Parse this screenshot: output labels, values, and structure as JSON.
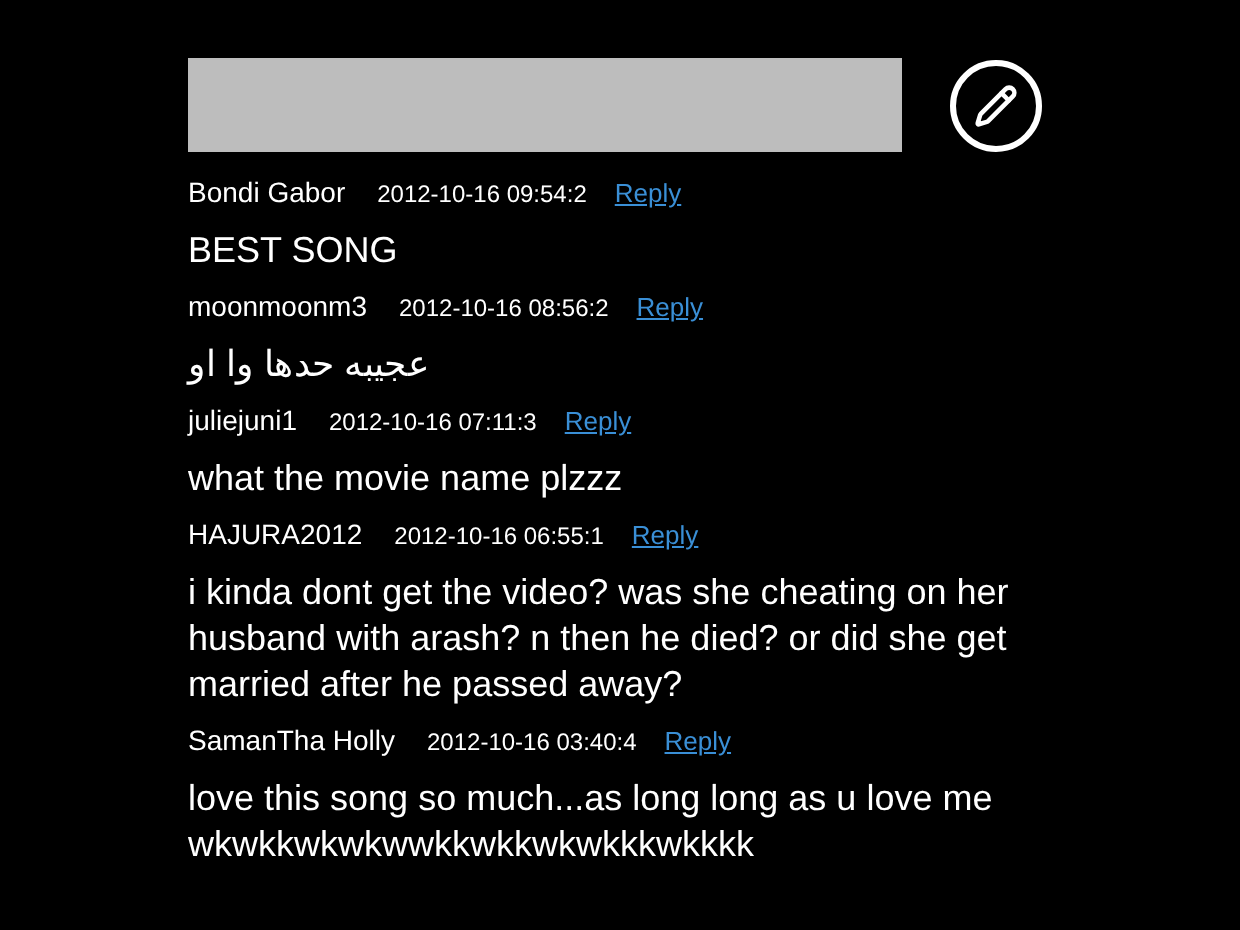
{
  "compose": {
    "kind": "input"
  },
  "comments": [
    {
      "author": "Bondi Gabor",
      "time": "2012-10-16 09:54:2",
      "reply": "Reply",
      "text": "BEST SONG"
    },
    {
      "author": "moonmoonm3",
      "time": "2012-10-16 08:56:2",
      "reply": "Reply",
      "text": "عجيبه حدها وا او"
    },
    {
      "author": "juliejuni1",
      "time": "2012-10-16 07:11:3",
      "reply": "Reply",
      "text": "what the movie name plzzz"
    },
    {
      "author": "HAJURA2012",
      "time": "2012-10-16 06:55:1",
      "reply": "Reply",
      "text": "i kinda dont get the video? was she cheating on her husband with arash? n then he died? or did she get married after he passed away?"
    },
    {
      "author": "SamanTha Holly",
      "time": "2012-10-16 03:40:4",
      "reply": "Reply",
      "text": "love this song so much...as long long as u love me wkwkkwkwkwwkkwkkwkwkkkwkkkk"
    }
  ]
}
